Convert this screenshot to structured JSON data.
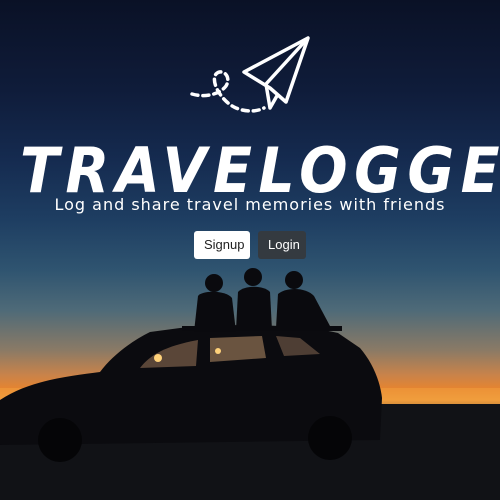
{
  "brand": {
    "logo_icon": "paper-plane-icon",
    "title": "TRAVELOGGER",
    "tagline": "Log and share travel memories with friends"
  },
  "actions": {
    "signup_label": "Signup",
    "login_label": "Login"
  },
  "colors": {
    "sky_top": "#0a1126",
    "horizon": "#f09a3a",
    "signup_bg": "#ffffff",
    "login_bg": "#343a40"
  }
}
